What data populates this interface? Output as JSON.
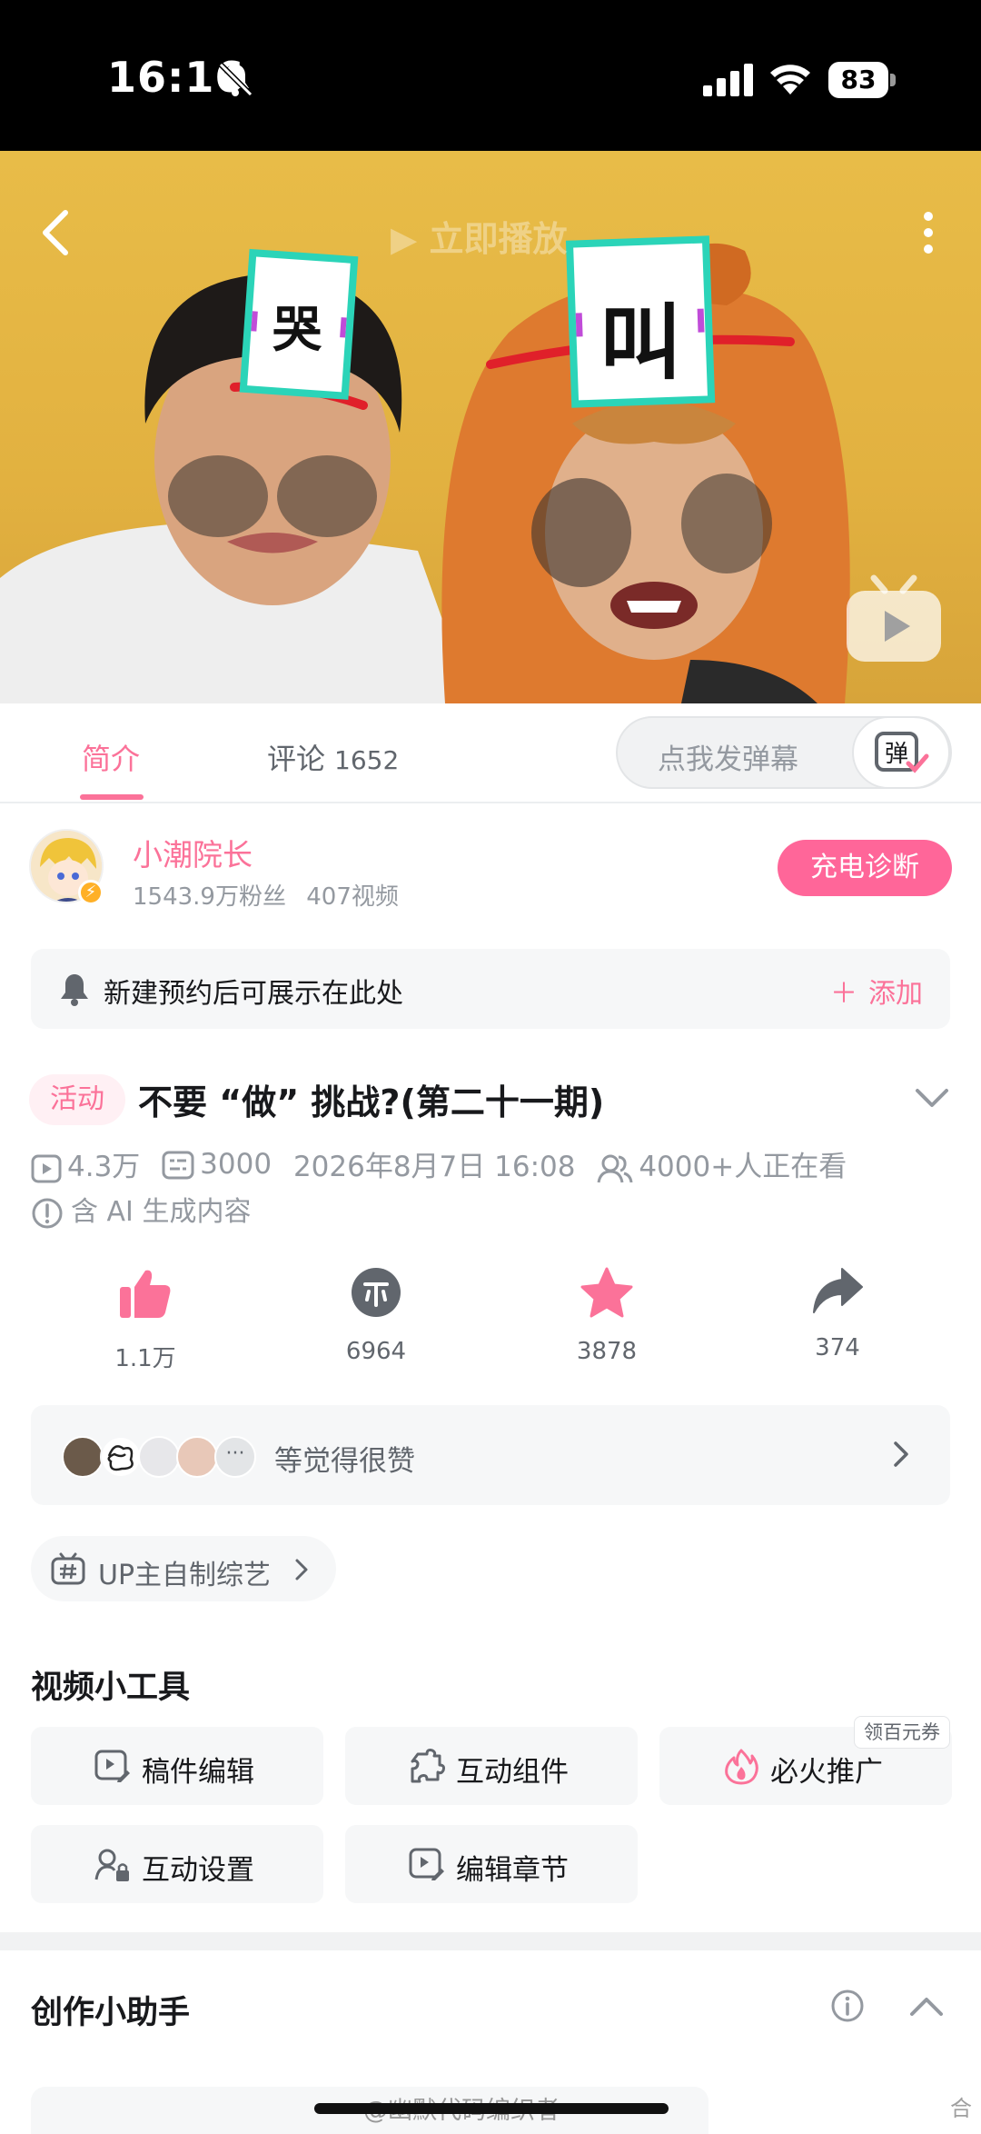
{
  "status_bar": {
    "time": "16:16",
    "battery": "83"
  },
  "video": {
    "overlay_play_text": "立即播放",
    "sign_left": "哭",
    "sign_right": "叫"
  },
  "tabs": {
    "intro": "简介",
    "comments": "评论",
    "comments_count": "1652",
    "danmaku_placeholder": "点我发弹幕",
    "danmaku_button": "弹"
  },
  "uploader": {
    "name": "小潮院长",
    "followers": "1543.9万粉丝",
    "videos": "407视频",
    "charge_button": "充电诊断"
  },
  "reservation": {
    "text": "新建预约后可展示在此处",
    "add_label": "添加"
  },
  "video_info": {
    "tag": "活动",
    "title": "不要 “做” 挑战?(第二十一期)",
    "views": "4.3万",
    "danmaku_count": "3000",
    "date": "2026年8月7日 16:08",
    "watching": "4000+人正在看",
    "ai_note": "含 AI 生成内容"
  },
  "actions": {
    "likes": "1.1万",
    "coins": "6964",
    "favorites": "3878",
    "shares": "374"
  },
  "likers": {
    "more": "···",
    "text": "等觉得很赞"
  },
  "topic": {
    "label": "UP主自制综艺"
  },
  "tools": {
    "title": "视频小工具",
    "items": [
      "稿件编辑",
      "互动组件",
      "必火推广",
      "互动设置",
      "编辑章节"
    ],
    "coupon": "领百元券"
  },
  "assistant": {
    "title": "创作小助手"
  },
  "watermark": {
    "text": "@幽默代码编织者",
    "right": "合"
  },
  "colors": {
    "pink": "#fb7299",
    "charge_pink": "#ff6699",
    "gray_text": "#9499a0",
    "bg_gray": "#f6f7f8"
  }
}
